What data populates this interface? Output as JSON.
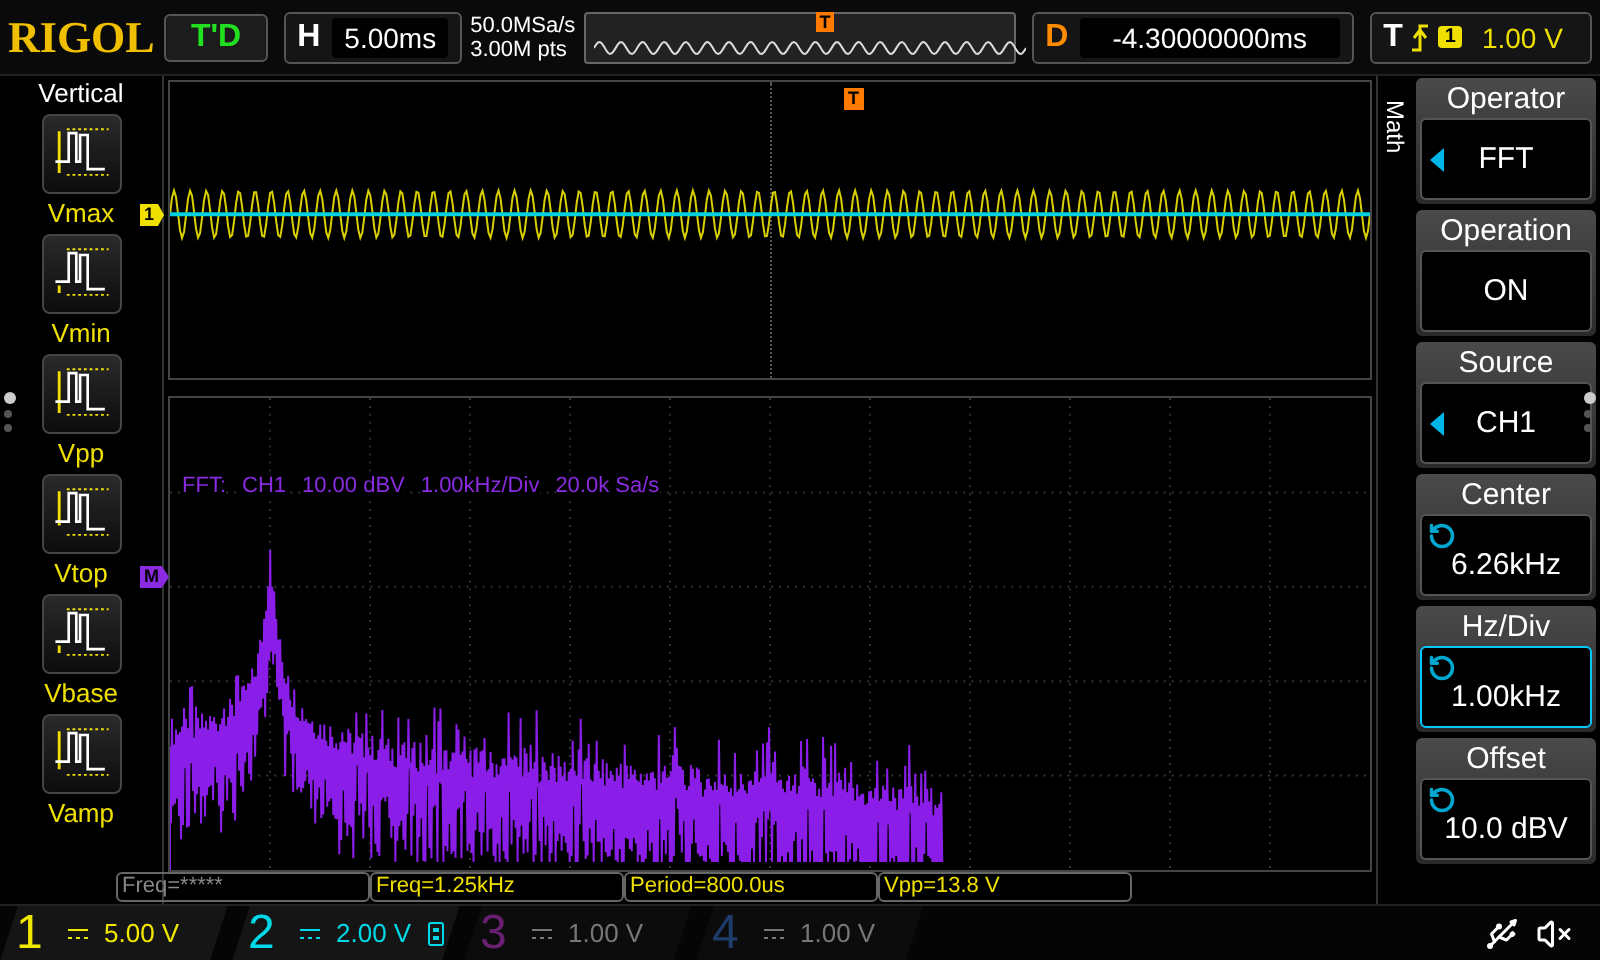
{
  "brand": "RIGOL",
  "run_state": "T'D",
  "timebase": {
    "label": "H",
    "value": "5.00ms"
  },
  "acquisition": {
    "sample_rate": "50.0MSa/s",
    "memory_depth": "3.00M pts"
  },
  "overview": {
    "trigger_label": "T"
  },
  "delay": {
    "label": "D",
    "value": "-4.30000000ms"
  },
  "trigger": {
    "label": "T",
    "source": "1",
    "level": "1.00 V"
  },
  "left_menu": {
    "title": "Vertical",
    "items": [
      {
        "label": "Vmax",
        "kind": "max"
      },
      {
        "label": "Vmin",
        "kind": "min"
      },
      {
        "label": "Vpp",
        "kind": "pp"
      },
      {
        "label": "Vtop",
        "kind": "top"
      },
      {
        "label": "Vbase",
        "kind": "base"
      },
      {
        "label": "Vamp",
        "kind": "amp"
      }
    ],
    "pages": [
      {
        "selected": true
      },
      {
        "selected": false
      },
      {
        "selected": false
      }
    ]
  },
  "waveform": {
    "trigger_label": "T",
    "channel_marker": "1"
  },
  "fft": {
    "marker": "M",
    "header": [
      "FFT:",
      "CH1",
      "10.00 dBV",
      "1.00kHz/Div",
      "20.0k Sa/s"
    ]
  },
  "side_tab": "Math",
  "right_menu": {
    "items": [
      {
        "title": "Operator",
        "value": "FFT",
        "kind": "arrow",
        "selected": false
      },
      {
        "title": "Operation",
        "value": "ON",
        "kind": "plain",
        "selected": false
      },
      {
        "title": "Source",
        "value": "CH1",
        "kind": "arrow",
        "selected": false
      },
      {
        "title": "Center",
        "value": "6.26kHz",
        "kind": "knob",
        "selected": false
      },
      {
        "title": "Hz/Div",
        "value": "1.00kHz",
        "kind": "knob",
        "selected": true
      },
      {
        "title": "Offset",
        "value": "10.0 dBV",
        "kind": "knob",
        "selected": false
      }
    ],
    "pages": [
      {
        "selected": true
      },
      {
        "selected": false
      },
      {
        "selected": false
      }
    ]
  },
  "measurements": [
    {
      "text": "Freq=*****",
      "disabled": true
    },
    {
      "text": "Freq=1.25kHz",
      "disabled": false
    },
    {
      "text": "Period=800.0us",
      "disabled": false
    },
    {
      "text": "Vpp=13.8 V",
      "disabled": false
    }
  ],
  "channels": [
    {
      "number": "1",
      "value": "5.00 V",
      "color": "#f0e800",
      "enabled": true,
      "bandwidth_limit": false
    },
    {
      "number": "2",
      "value": "2.00 V",
      "color": "#00d8e8",
      "enabled": true,
      "bandwidth_limit": true
    },
    {
      "number": "3",
      "value": "1.00 V",
      "color": "#6a2070",
      "enabled": false,
      "bandwidth_limit": false
    },
    {
      "number": "4",
      "value": "1.00 V",
      "color": "#1e3c6a",
      "enabled": false,
      "bandwidth_limit": false
    }
  ]
}
